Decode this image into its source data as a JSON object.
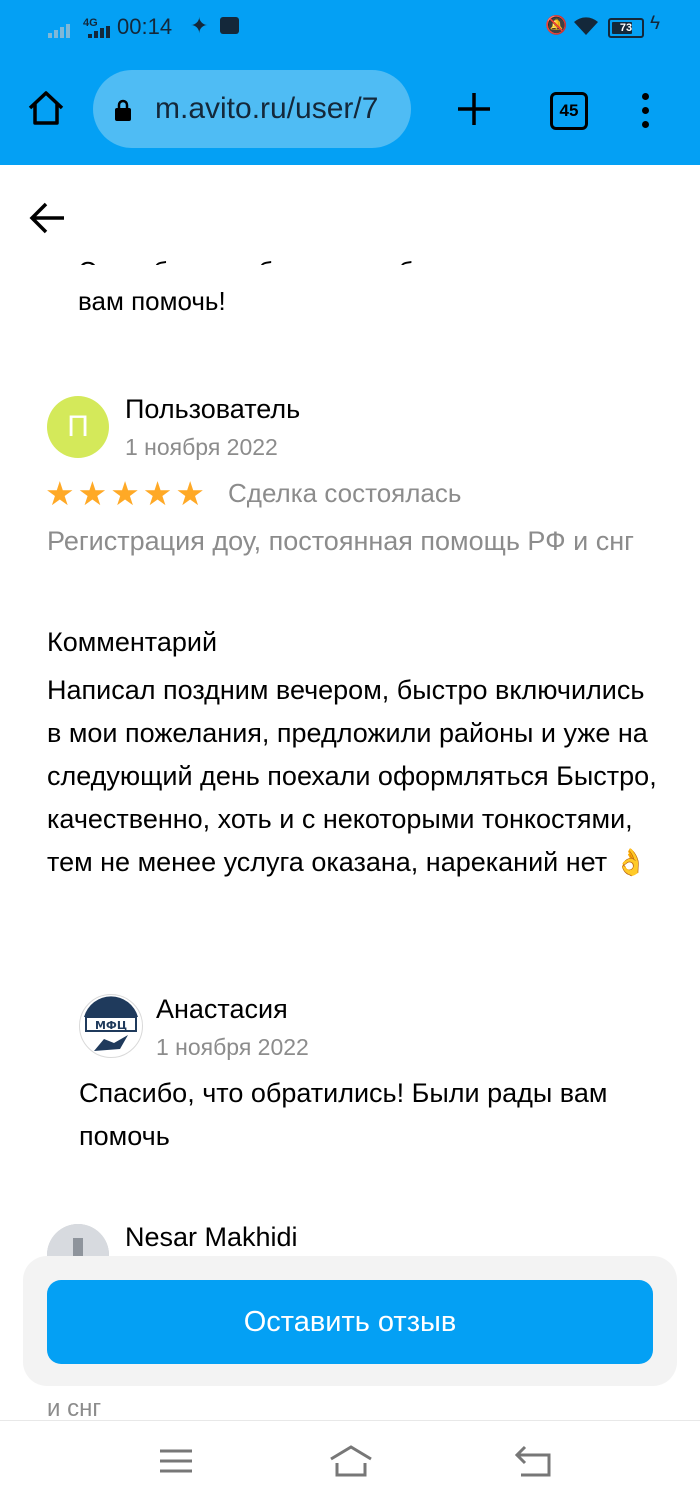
{
  "status_bar": {
    "network": "4G",
    "time": "00:14",
    "battery": "73",
    "battery_level": 0.73
  },
  "browser": {
    "url": "m.avito.ru/user/7",
    "tab_count": "45",
    "accent_color": "#04a0f4"
  },
  "previous_reply": {
    "clipped_line": "Спасибо, что обратились, были рады",
    "last_line": "вам помочь!"
  },
  "review": {
    "avatar_letter": "П",
    "author": "Пользователь",
    "date": "1 ноября 2022",
    "rating": 5,
    "deal_status": "Сделка состоялась",
    "service": "Регистрация доу, постоянная помощь РФ и снг",
    "comment_label": "Комментарий",
    "comment": "Написал поздним вечером, быстро включились в мои пожелания, предложили районы и уже на следующий день поехали оформляться Быстро, качественно, хоть и с некоторыми тонкостями, тем не менее услуга оказана, нареканий нет",
    "emoji": "👌"
  },
  "reply": {
    "logo_text": "МФЦ",
    "author": "Анастасия",
    "date": "1 ноября 2022",
    "text": "Спасибо, что обратились! Были рады вам помочь"
  },
  "next_review": {
    "author": "Nesar Makhidi",
    "tail_text": "и снг"
  },
  "cta": {
    "label": "Оставить отзыв"
  }
}
